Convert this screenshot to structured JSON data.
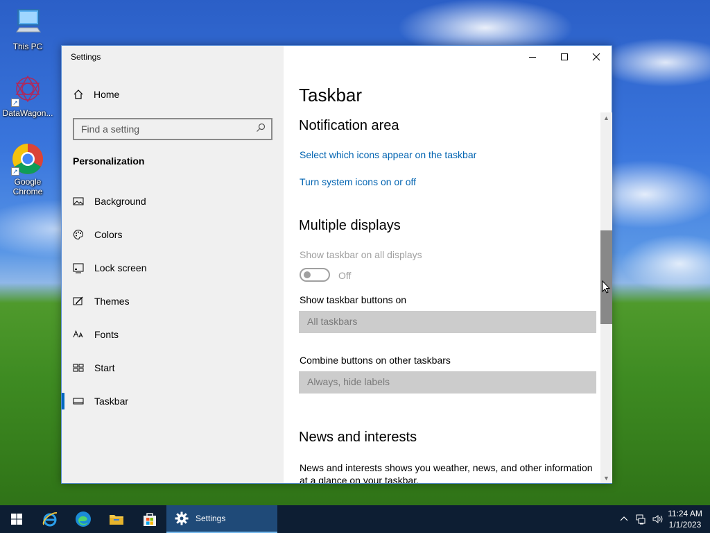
{
  "desktop": {
    "icons": [
      {
        "label": "This PC"
      },
      {
        "label": "DataWagon..."
      },
      {
        "label": "Google Chrome"
      }
    ]
  },
  "window": {
    "title": "Settings",
    "controls": {
      "minimize": "minimize",
      "maximize": "maximize",
      "close": "close"
    }
  },
  "sidebar": {
    "home_label": "Home",
    "search_placeholder": "Find a setting",
    "section": "Personalization",
    "items": [
      {
        "label": "Background",
        "icon": "image-icon"
      },
      {
        "label": "Colors",
        "icon": "palette-icon"
      },
      {
        "label": "Lock screen",
        "icon": "lock-screen-icon"
      },
      {
        "label": "Themes",
        "icon": "themes-icon"
      },
      {
        "label": "Fonts",
        "icon": "fonts-icon"
      },
      {
        "label": "Start",
        "icon": "start-icon"
      },
      {
        "label": "Taskbar",
        "icon": "taskbar-icon",
        "selected": true
      }
    ]
  },
  "content": {
    "page_title": "Taskbar",
    "notification_area": {
      "heading": "Notification area",
      "link1": "Select which icons appear on the taskbar",
      "link2": "Turn system icons on or off"
    },
    "multiple_displays": {
      "heading": "Multiple displays",
      "show_all_label": "Show taskbar on all displays",
      "toggle_state": "Off",
      "buttons_on_label": "Show taskbar buttons on",
      "buttons_on_value": "All taskbars",
      "combine_label": "Combine buttons on other taskbars",
      "combine_value": "Always, hide labels"
    },
    "news": {
      "heading": "News and interests",
      "description": "News and interests shows you weather, news, and other information at a glance on your taskbar."
    }
  },
  "taskbar": {
    "active_app": "Settings",
    "clock_time": "11:24 AM",
    "clock_date": "1/1/2023"
  }
}
